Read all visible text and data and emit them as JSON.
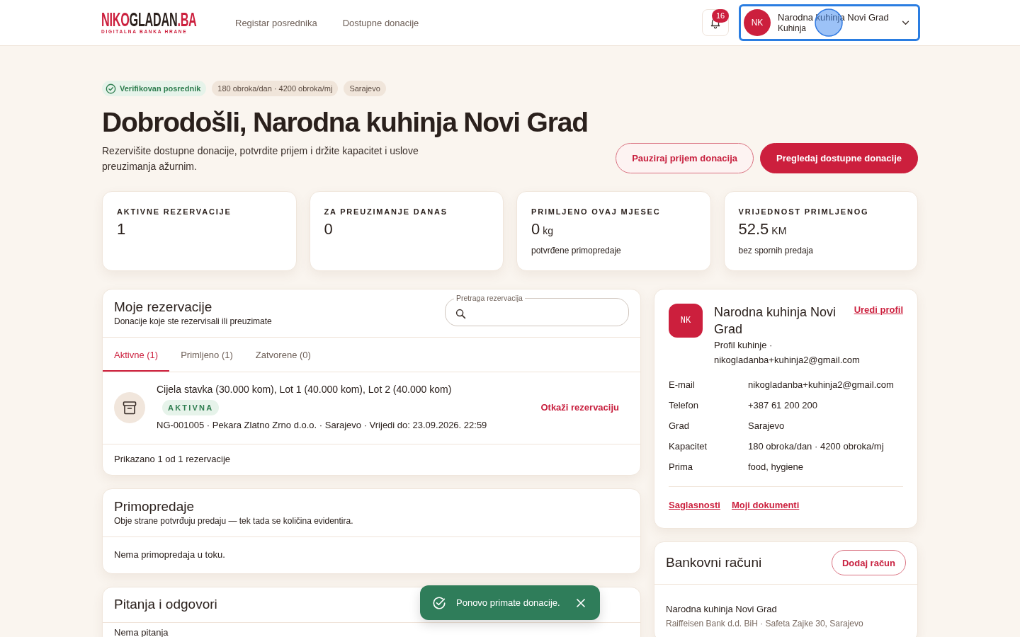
{
  "header": {
    "logo": {
      "parts": [
        {
          "text": "NIKO",
          "accent": true
        },
        {
          "text": "GLADAN",
          "accent": false
        },
        {
          "text": ".BA",
          "accent": true
        }
      ],
      "tagline": "DIGITALNA BANKA HRANE"
    },
    "nav": [
      {
        "label": "Registar posrednika"
      },
      {
        "label": "Dostupne donacije"
      }
    ],
    "notifications": {
      "count": "16"
    },
    "account": {
      "initials": "NK",
      "name": "Narodna kuhinja Novi Grad",
      "role": "Kuhinja",
      "focused": true
    }
  },
  "hero": {
    "badges": [
      {
        "kind": "verified",
        "label": "Verifikovan posrednik"
      },
      {
        "kind": "plain",
        "label": "180 obroka/dan · 4200 obroka/mj"
      },
      {
        "kind": "plain",
        "label": "Sarajevo"
      }
    ],
    "title": "Dobrodošli, Narodna kuhinja Novi Grad",
    "subtitle": "Rezervišite dostupne donacije, potvrdite prijem i držite kapacitet i uslove preuzimanja ažurnim.",
    "actions": [
      {
        "kind": "secondary",
        "label": "Pauziraj prijem donacija"
      },
      {
        "kind": "primary",
        "label": "Pregledaj dostupne donacije"
      }
    ]
  },
  "stats": [
    {
      "label": "AKTIVNE REZERVACIJE",
      "value": "1"
    },
    {
      "label": "ZA PREUZIMANJE DANAS",
      "value": "0"
    },
    {
      "label": "PRIMLJENO OVAJ MJESEC",
      "value": "0",
      "unit": "kg",
      "note": "potvrđene primopredaje"
    },
    {
      "label": "VRIJEDNOST PRIMLJENOG",
      "value": "52.5",
      "unit": "KM",
      "note": "bez spornih predaja"
    }
  ],
  "reservations": {
    "title": "Moje rezervacije",
    "subtitle": "Donacije koje ste rezervisali ili preuzimate",
    "search": {
      "label": "Pretraga rezervacija"
    },
    "tabs": [
      {
        "label": "Aktivne (1)",
        "selected": true
      },
      {
        "label": "Primljeno (1)",
        "selected": false
      },
      {
        "label": "Zatvorene (0)",
        "selected": false
      }
    ],
    "items": [
      {
        "title": "Cijela stavka (30.000 kom), Lot 1 (40.000 kom), Lot 2 (40.000 kom)",
        "status": "AKTIVNA",
        "meta": "NG-001005 · Pekara Zlatno Zrno d.o.o. · Sarajevo · Vrijedi do: 23.09.2026. 22:59",
        "action": "Otkaži rezervaciju"
      }
    ],
    "footer": "Prikazano 1 od 1 rezervacije"
  },
  "handovers": {
    "title": "Primopredaje",
    "subtitle": "Obje strane potvrđuju predaju — tek tada se količina evidentira.",
    "empty": "Nema primopredaja u toku."
  },
  "qa": {
    "title": "Pitanja i odgovori",
    "empty": "Nema pitanja"
  },
  "profile": {
    "initials": "NK",
    "name": "Narodna kuhinja Novi Grad",
    "edit_link": "Uredi profil",
    "subtitle": "Profil kuhinje · nikogladanba+kuhinja2@gmail.com",
    "details": [
      {
        "label": "E-mail",
        "value": "nikogladanba+kuhinja2@gmail.com"
      },
      {
        "label": "Telefon",
        "value": "+387 61 200 200"
      },
      {
        "label": "Grad",
        "value": "Sarajevo"
      },
      {
        "label": "Kapacitet",
        "value": "180 obroka/dan · 4200 obroka/mj"
      },
      {
        "label": "Prima",
        "value": "food, hygiene"
      }
    ],
    "links": [
      "Saglasnosti",
      "Moji dokumenti"
    ]
  },
  "bank_accounts": {
    "title": "Bankovni računi",
    "add_button": "Dodaj račun",
    "accounts": [
      {
        "holder": "Narodna kuhinja Novi Grad",
        "details": "Raiffeisen Bank d.d. BiH · Safeta Zajke 30, Sarajevo"
      }
    ]
  },
  "toast": {
    "message": "Ponovo primate donacije."
  }
}
